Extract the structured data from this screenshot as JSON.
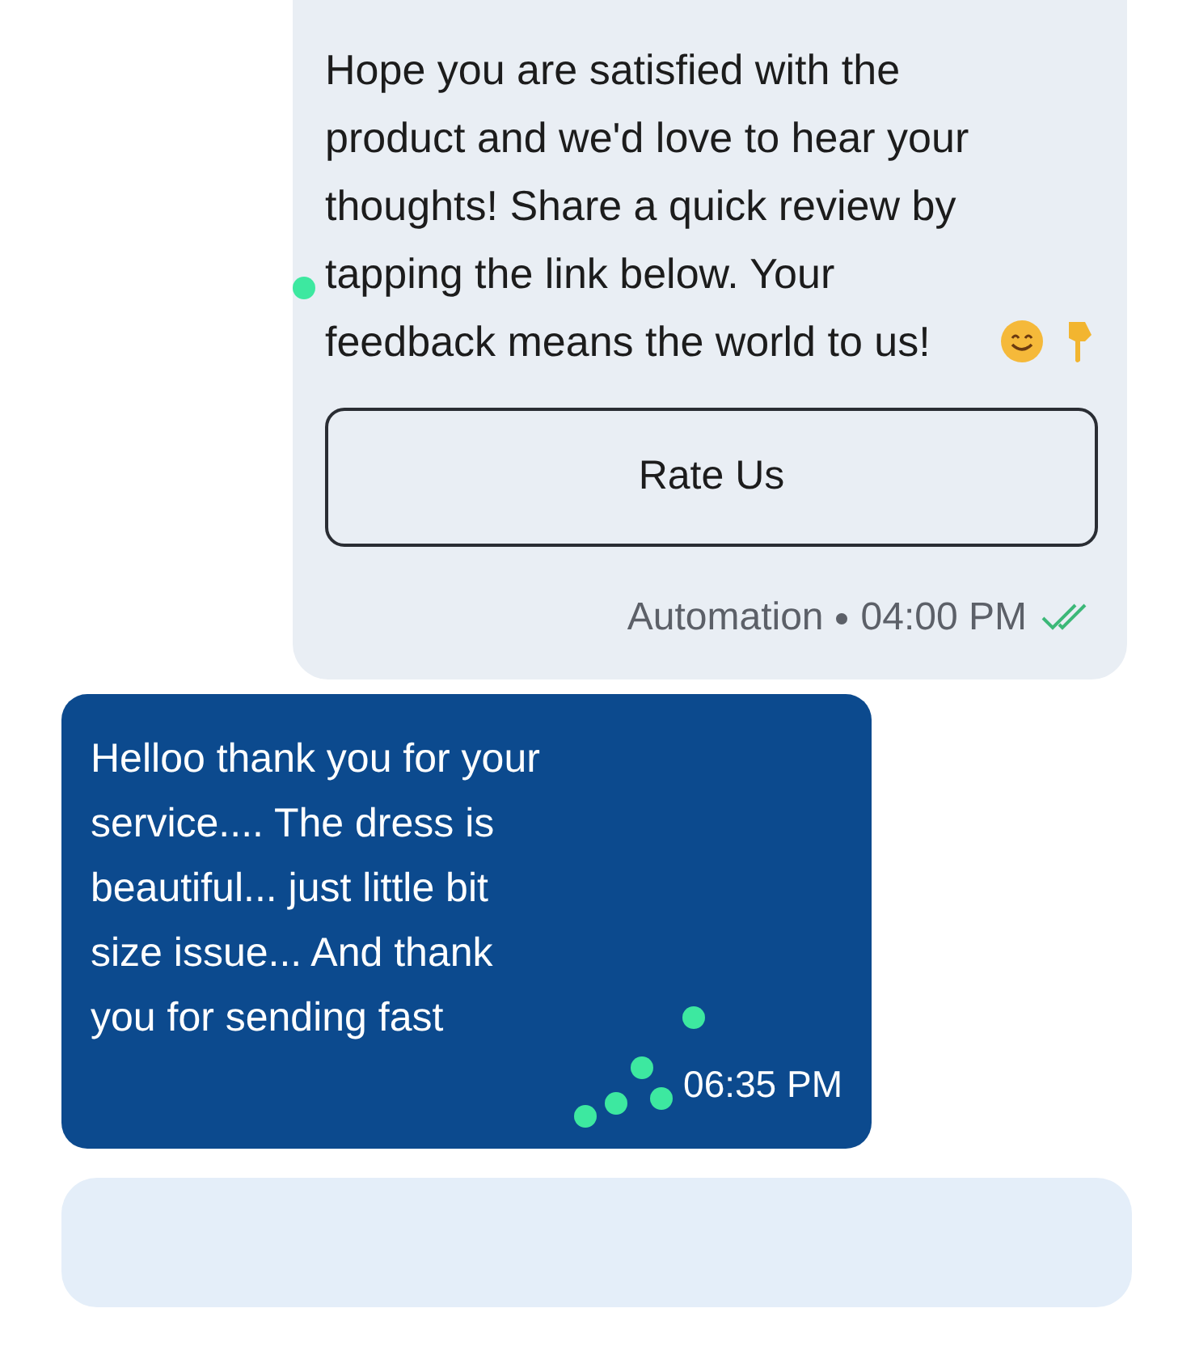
{
  "messages": [
    {
      "kind": "outgoing",
      "text": "Hope you are satisfied with the product and we'd love to hear your thoughts! Share a quick review by tapping the link below. Your feedback means the world to us!",
      "button": "Rate Us",
      "sender": "Automation",
      "time": "04:00 PM",
      "read": true
    },
    {
      "kind": "incoming",
      "text": "Helloo thank you for your service.... The dress is beautiful... just little bit size issue... And thank you for sending fast",
      "time": "06:35 PM"
    },
    {
      "kind": "note"
    }
  ]
}
